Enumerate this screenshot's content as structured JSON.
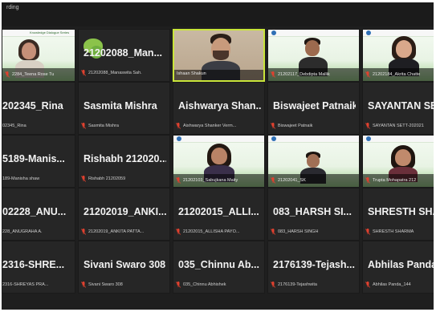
{
  "window": {
    "recording_label": "rding"
  },
  "colors": {
    "background": "#1f1f1f",
    "tile": "#262626",
    "active_speaker_border": "#c9e53a",
    "muted_mic": "#e0412f",
    "slide_green": "#9fd18f"
  },
  "slide": {
    "title": "Knowledge Dialogue Series"
  },
  "tiles": [
    {
      "big": "",
      "plate": "2284_Teena Rose Tu",
      "video": true
    },
    {
      "big": "21202088_Man...",
      "plate": "21202088_Manaswita Sah.",
      "video": false
    },
    {
      "big": "",
      "plate": "Ishaan Shakun",
      "video": true
    },
    {
      "big": "",
      "plate": "21202117_Debdipta Mallik",
      "video": true
    },
    {
      "big": "",
      "plate": "21202184_Akrita Chatte",
      "video": true
    },
    {
      "big": "202345_Rina",
      "plate": "02345_Rina",
      "video": false
    },
    {
      "big": "Sasmita Mishra",
      "plate": "Sasmita Mishra",
      "video": false
    },
    {
      "big": "Aishwarya Shan...",
      "plate": "Aishwarya Shanker Verm...",
      "video": false
    },
    {
      "big": "Biswajeet Patnaik",
      "plate": "Biswajeet Patnaik",
      "video": false
    },
    {
      "big": "SAYANTAN SET...",
      "plate": "SAYANTAN SETT-202021",
      "video": false
    },
    {
      "big": "5189-Manis...",
      "plate": "189-Manisha shaw",
      "video": false
    },
    {
      "big": "Rishabh 212020...",
      "plate": "Rishabh 21202059",
      "video": false
    },
    {
      "big": "",
      "plate": "21202103_Sabujkana Maity",
      "video": true
    },
    {
      "big": "",
      "plate": "21202041_SK",
      "video": true
    },
    {
      "big": "",
      "plate": "Trupta Mohapatra 212",
      "video": true
    },
    {
      "big": "02228_ANU...",
      "plate": "228_ANUGRAHA A.",
      "video": false
    },
    {
      "big": "21202019_ANKI...",
      "plate": "21202019_ANKITA PATTA...",
      "video": false
    },
    {
      "big": "21202015_ALLI...",
      "plate": "21202015_ALLISHA PAYO...",
      "video": false
    },
    {
      "big": "083_HARSH SI...",
      "plate": "083_HARSH SINGH",
      "video": false
    },
    {
      "big": "SHRESTH SHAR...",
      "plate": "SHRESTH SHARMA",
      "video": false
    },
    {
      "big": "2316-SHRE...",
      "plate": "2316-SHREYAS PRA...",
      "video": false
    },
    {
      "big": "Sivani Swaro 308",
      "plate": "Sivani Swaro 308",
      "video": false
    },
    {
      "big": "035_Chinnu Ab...",
      "plate": "035_Chinnu Abhishek",
      "video": false
    },
    {
      "big": "2176139-Tejash...",
      "plate": "2176139-Tejashwita",
      "video": false
    },
    {
      "big": "Abhilas Panda_...",
      "plate": "Abhilas Panda_144",
      "video": false
    }
  ]
}
